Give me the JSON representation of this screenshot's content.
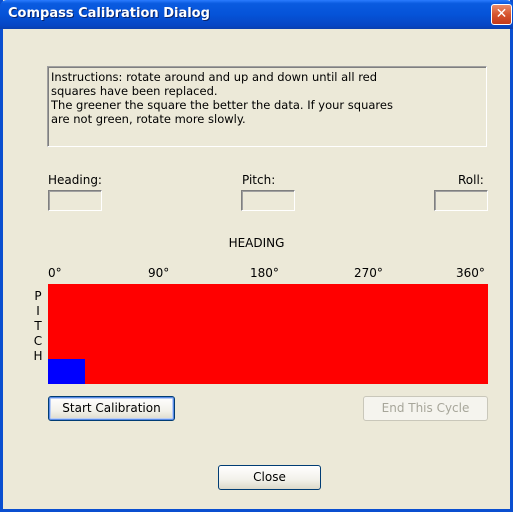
{
  "window": {
    "title": "Compass Calibration Dialog",
    "close_glyph": "✕"
  },
  "instructions": {
    "lines": [
      "Instructions: rotate around and up and down until all red",
      "squares have been replaced.",
      "The greener the square the better the data.  If your squares",
      "are not green, rotate more slowly."
    ]
  },
  "readouts": {
    "heading_label": "Heading:",
    "heading_value": "",
    "pitch_label": "Pitch:",
    "pitch_value": "",
    "roll_label": "Roll:",
    "roll_value": ""
  },
  "grid": {
    "title": "HEADING",
    "x_ticks": [
      "0°",
      "90°",
      "180°",
      "270°",
      "360°"
    ],
    "y_label_letters": [
      "P",
      "I",
      "T",
      "C",
      "H"
    ],
    "background_color": "#ff0000",
    "filled_cells": [
      {
        "heading_range_deg": [
          0,
          30
        ],
        "pitch_row": "bottom",
        "color": "#0000ff"
      }
    ]
  },
  "buttons": {
    "start_label": "Start Calibration",
    "end_label": "End This Cycle",
    "close_label": "Close"
  }
}
